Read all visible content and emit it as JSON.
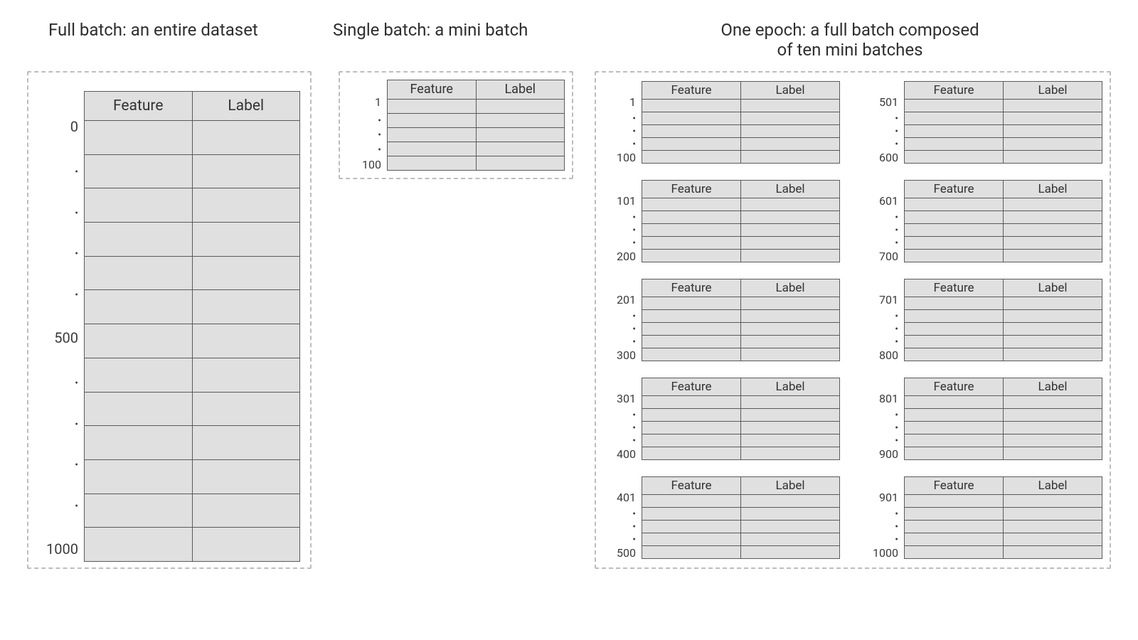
{
  "titles": {
    "full": "Full batch: an entire dataset",
    "single": "Single batch: a mini batch",
    "epoch_l1": "One epoch: a full batch composed",
    "epoch_l2": "of ten mini batches"
  },
  "headers": {
    "feature": "Feature",
    "label": "Label"
  },
  "full_batch": {
    "top": "0",
    "mid": "500",
    "bot": "1000",
    "row_count": 13
  },
  "single_batch": {
    "top": "1",
    "bot": "100",
    "row_count": 5
  },
  "epoch": {
    "left": [
      {
        "top": "1",
        "bot": "100"
      },
      {
        "top": "101",
        "bot": "200"
      },
      {
        "top": "201",
        "bot": "300"
      },
      {
        "top": "301",
        "bot": "400"
      },
      {
        "top": "401",
        "bot": "500"
      }
    ],
    "right": [
      {
        "top": "501",
        "bot": "600"
      },
      {
        "top": "601",
        "bot": "700"
      },
      {
        "top": "701",
        "bot": "800"
      },
      {
        "top": "801",
        "bot": "900"
      },
      {
        "top": "901",
        "bot": "1000"
      }
    ],
    "row_count": 5
  },
  "dot": "•"
}
